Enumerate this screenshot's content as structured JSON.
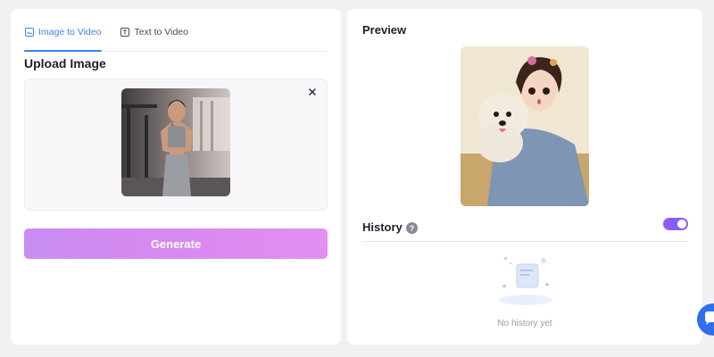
{
  "tabs": [
    {
      "label": "Image to Video",
      "icon": "image-icon",
      "active": true
    },
    {
      "label": "Text to Video",
      "icon": "text-icon",
      "active": false
    }
  ],
  "upload": {
    "title": "Upload Image",
    "close_icon": "close-icon"
  },
  "generate": {
    "label": "Generate"
  },
  "preview": {
    "title": "Preview"
  },
  "history": {
    "title": "History",
    "help_icon": "?",
    "toggle_on": true,
    "empty_text": "No history yet"
  },
  "colors": {
    "accent": "#3b82f6",
    "generate_gradient_start": "#c88cf2",
    "generate_gradient_end": "#e38ff0",
    "toggle": "#8b5cf6",
    "chat": "#2f6fed"
  }
}
